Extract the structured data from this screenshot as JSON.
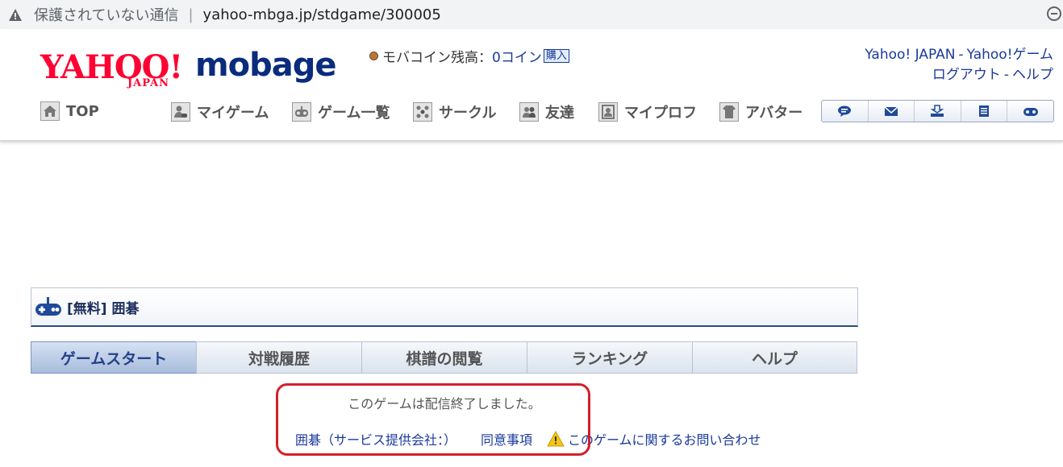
{
  "browser": {
    "security_text": "保護されていない通信",
    "separator": "|",
    "url": "yahoo-mbga.jp/stdgame/300005"
  },
  "header": {
    "logo_yahoo": "YAHOO!",
    "logo_japan": "JAPAN",
    "logo_mobage": "mobage",
    "coin_label": "モバコイン残高：",
    "coin_amount": "0コイン",
    "coin_buy": "購入",
    "link_yahoo_japan": "Yahoo! JAPAN",
    "link_yahoo_game": "Yahoo!ゲーム",
    "link_logout": "ログアウト",
    "link_help": "ヘルプ",
    "dash": "-"
  },
  "nav": {
    "items": [
      {
        "label": "TOP",
        "icon": "home-icon"
      },
      {
        "label": "マイゲーム",
        "icon": "my-game-icon"
      },
      {
        "label": "ゲーム一覧",
        "icon": "game-list-icon"
      },
      {
        "label": "サークル",
        "icon": "circle-icon"
      },
      {
        "label": "友達",
        "icon": "friends-icon"
      },
      {
        "label": "マイプロフ",
        "icon": "profile-icon"
      },
      {
        "label": "アバター",
        "icon": "avatar-icon"
      }
    ],
    "icon_buttons": [
      "chat-icon",
      "mail-icon",
      "inbox-icon",
      "list-icon",
      "gamepad-icon"
    ]
  },
  "game": {
    "title": "[無料] 囲碁",
    "tabs": [
      "ゲームスタート",
      "対戦履歴",
      "棋譜の閲覧",
      "ランキング",
      "ヘルプ"
    ],
    "active_tab": "ゲームスタート",
    "notice": "このゲームは配信終了しました。",
    "link_provider": "囲碁（サービス提供会社：）",
    "link_terms": "同意事項",
    "link_contact": "このゲームに関するお問い合わせ"
  },
  "colors": {
    "link": "#1a3a9c",
    "yahoo_red": "#ff0033",
    "mobage_navy": "#0a2c7d",
    "highlight_box": "#d3202a"
  }
}
